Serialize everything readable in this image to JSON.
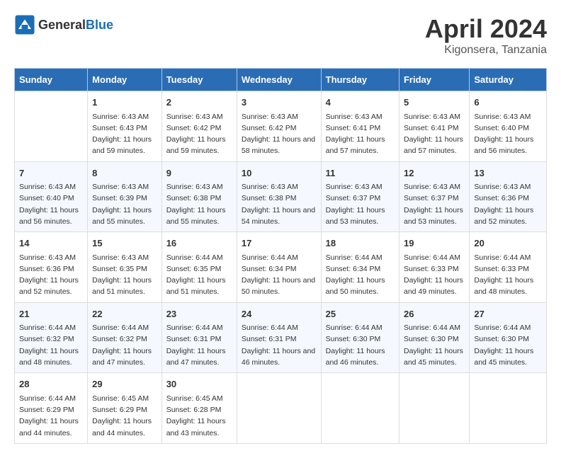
{
  "header": {
    "logo_general": "General",
    "logo_blue": "Blue",
    "title": "April 2024",
    "subtitle": "Kigonsera, Tanzania"
  },
  "calendar": {
    "days_of_week": [
      "Sunday",
      "Monday",
      "Tuesday",
      "Wednesday",
      "Thursday",
      "Friday",
      "Saturday"
    ],
    "weeks": [
      [
        {
          "day": "",
          "sunrise": "",
          "sunset": "",
          "daylight": ""
        },
        {
          "day": "1",
          "sunrise": "Sunrise: 6:43 AM",
          "sunset": "Sunset: 6:43 PM",
          "daylight": "Daylight: 11 hours and 59 minutes."
        },
        {
          "day": "2",
          "sunrise": "Sunrise: 6:43 AM",
          "sunset": "Sunset: 6:42 PM",
          "daylight": "Daylight: 11 hours and 59 minutes."
        },
        {
          "day": "3",
          "sunrise": "Sunrise: 6:43 AM",
          "sunset": "Sunset: 6:42 PM",
          "daylight": "Daylight: 11 hours and 58 minutes."
        },
        {
          "day": "4",
          "sunrise": "Sunrise: 6:43 AM",
          "sunset": "Sunset: 6:41 PM",
          "daylight": "Daylight: 11 hours and 57 minutes."
        },
        {
          "day": "5",
          "sunrise": "Sunrise: 6:43 AM",
          "sunset": "Sunset: 6:41 PM",
          "daylight": "Daylight: 11 hours and 57 minutes."
        },
        {
          "day": "6",
          "sunrise": "Sunrise: 6:43 AM",
          "sunset": "Sunset: 6:40 PM",
          "daylight": "Daylight: 11 hours and 56 minutes."
        }
      ],
      [
        {
          "day": "7",
          "sunrise": "Sunrise: 6:43 AM",
          "sunset": "Sunset: 6:40 PM",
          "daylight": "Daylight: 11 hours and 56 minutes."
        },
        {
          "day": "8",
          "sunrise": "Sunrise: 6:43 AM",
          "sunset": "Sunset: 6:39 PM",
          "daylight": "Daylight: 11 hours and 55 minutes."
        },
        {
          "day": "9",
          "sunrise": "Sunrise: 6:43 AM",
          "sunset": "Sunset: 6:38 PM",
          "daylight": "Daylight: 11 hours and 55 minutes."
        },
        {
          "day": "10",
          "sunrise": "Sunrise: 6:43 AM",
          "sunset": "Sunset: 6:38 PM",
          "daylight": "Daylight: 11 hours and 54 minutes."
        },
        {
          "day": "11",
          "sunrise": "Sunrise: 6:43 AM",
          "sunset": "Sunset: 6:37 PM",
          "daylight": "Daylight: 11 hours and 53 minutes."
        },
        {
          "day": "12",
          "sunrise": "Sunrise: 6:43 AM",
          "sunset": "Sunset: 6:37 PM",
          "daylight": "Daylight: 11 hours and 53 minutes."
        },
        {
          "day": "13",
          "sunrise": "Sunrise: 6:43 AM",
          "sunset": "Sunset: 6:36 PM",
          "daylight": "Daylight: 11 hours and 52 minutes."
        }
      ],
      [
        {
          "day": "14",
          "sunrise": "Sunrise: 6:43 AM",
          "sunset": "Sunset: 6:36 PM",
          "daylight": "Daylight: 11 hours and 52 minutes."
        },
        {
          "day": "15",
          "sunrise": "Sunrise: 6:43 AM",
          "sunset": "Sunset: 6:35 PM",
          "daylight": "Daylight: 11 hours and 51 minutes."
        },
        {
          "day": "16",
          "sunrise": "Sunrise: 6:44 AM",
          "sunset": "Sunset: 6:35 PM",
          "daylight": "Daylight: 11 hours and 51 minutes."
        },
        {
          "day": "17",
          "sunrise": "Sunrise: 6:44 AM",
          "sunset": "Sunset: 6:34 PM",
          "daylight": "Daylight: 11 hours and 50 minutes."
        },
        {
          "day": "18",
          "sunrise": "Sunrise: 6:44 AM",
          "sunset": "Sunset: 6:34 PM",
          "daylight": "Daylight: 11 hours and 50 minutes."
        },
        {
          "day": "19",
          "sunrise": "Sunrise: 6:44 AM",
          "sunset": "Sunset: 6:33 PM",
          "daylight": "Daylight: 11 hours and 49 minutes."
        },
        {
          "day": "20",
          "sunrise": "Sunrise: 6:44 AM",
          "sunset": "Sunset: 6:33 PM",
          "daylight": "Daylight: 11 hours and 48 minutes."
        }
      ],
      [
        {
          "day": "21",
          "sunrise": "Sunrise: 6:44 AM",
          "sunset": "Sunset: 6:32 PM",
          "daylight": "Daylight: 11 hours and 48 minutes."
        },
        {
          "day": "22",
          "sunrise": "Sunrise: 6:44 AM",
          "sunset": "Sunset: 6:32 PM",
          "daylight": "Daylight: 11 hours and 47 minutes."
        },
        {
          "day": "23",
          "sunrise": "Sunrise: 6:44 AM",
          "sunset": "Sunset: 6:31 PM",
          "daylight": "Daylight: 11 hours and 47 minutes."
        },
        {
          "day": "24",
          "sunrise": "Sunrise: 6:44 AM",
          "sunset": "Sunset: 6:31 PM",
          "daylight": "Daylight: 11 hours and 46 minutes."
        },
        {
          "day": "25",
          "sunrise": "Sunrise: 6:44 AM",
          "sunset": "Sunset: 6:30 PM",
          "daylight": "Daylight: 11 hours and 46 minutes."
        },
        {
          "day": "26",
          "sunrise": "Sunrise: 6:44 AM",
          "sunset": "Sunset: 6:30 PM",
          "daylight": "Daylight: 11 hours and 45 minutes."
        },
        {
          "day": "27",
          "sunrise": "Sunrise: 6:44 AM",
          "sunset": "Sunset: 6:30 PM",
          "daylight": "Daylight: 11 hours and 45 minutes."
        }
      ],
      [
        {
          "day": "28",
          "sunrise": "Sunrise: 6:44 AM",
          "sunset": "Sunset: 6:29 PM",
          "daylight": "Daylight: 11 hours and 44 minutes."
        },
        {
          "day": "29",
          "sunrise": "Sunrise: 6:45 AM",
          "sunset": "Sunset: 6:29 PM",
          "daylight": "Daylight: 11 hours and 44 minutes."
        },
        {
          "day": "30",
          "sunrise": "Sunrise: 6:45 AM",
          "sunset": "Sunset: 6:28 PM",
          "daylight": "Daylight: 11 hours and 43 minutes."
        },
        {
          "day": "",
          "sunrise": "",
          "sunset": "",
          "daylight": ""
        },
        {
          "day": "",
          "sunrise": "",
          "sunset": "",
          "daylight": ""
        },
        {
          "day": "",
          "sunrise": "",
          "sunset": "",
          "daylight": ""
        },
        {
          "day": "",
          "sunrise": "",
          "sunset": "",
          "daylight": ""
        }
      ]
    ]
  }
}
